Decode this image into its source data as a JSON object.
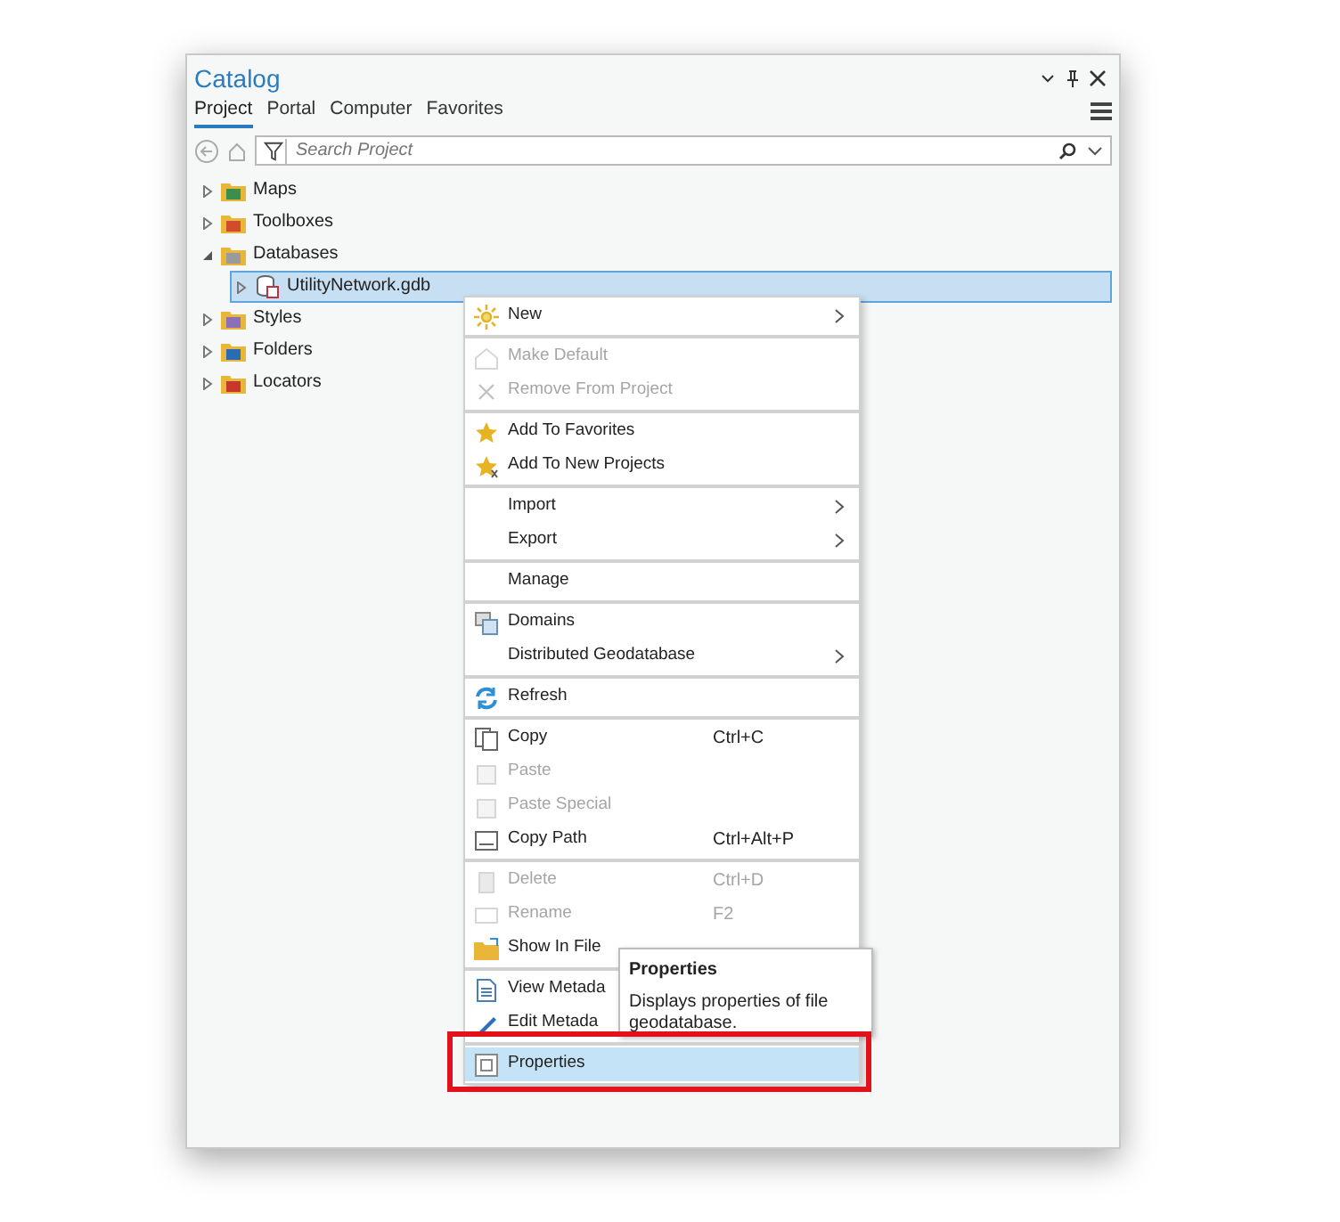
{
  "window": {
    "title": "Catalog"
  },
  "tabs": [
    {
      "label": "Project",
      "selected": true
    },
    {
      "label": "Portal",
      "selected": false
    },
    {
      "label": "Computer",
      "selected": false
    },
    {
      "label": "Favorites",
      "selected": false
    }
  ],
  "search": {
    "placeholder": "Search Project"
  },
  "tree": [
    {
      "label": "Maps",
      "expanded": false,
      "selected": false
    },
    {
      "label": "Toolboxes",
      "expanded": false,
      "selected": false
    },
    {
      "label": "Databases",
      "expanded": true,
      "selected": false,
      "children": [
        {
          "label": "UtilityNetwork.gdb",
          "expanded": false,
          "selected": true
        }
      ]
    },
    {
      "label": "Styles",
      "expanded": false,
      "selected": false
    },
    {
      "label": "Folders",
      "expanded": false,
      "selected": false
    },
    {
      "label": "Locators",
      "expanded": false,
      "selected": false
    }
  ],
  "context_menu": [
    {
      "kind": "item",
      "label": "New",
      "disabled": false,
      "submenu": true,
      "selected": false
    },
    {
      "kind": "separator"
    },
    {
      "kind": "item",
      "label": "Make Default",
      "disabled": true,
      "submenu": false,
      "selected": false
    },
    {
      "kind": "item",
      "label": "Remove From Project",
      "disabled": true,
      "submenu": false,
      "selected": false
    },
    {
      "kind": "separator"
    },
    {
      "kind": "item",
      "label": "Add To Favorites",
      "disabled": false,
      "submenu": false,
      "selected": false
    },
    {
      "kind": "item",
      "label": "Add To New Projects",
      "disabled": false,
      "submenu": false,
      "selected": false
    },
    {
      "kind": "separator"
    },
    {
      "kind": "item",
      "label": "Import",
      "disabled": false,
      "submenu": true,
      "selected": false
    },
    {
      "kind": "item",
      "label": "Export",
      "disabled": false,
      "submenu": true,
      "selected": false
    },
    {
      "kind": "separator"
    },
    {
      "kind": "item",
      "label": "Manage",
      "disabled": false,
      "submenu": false,
      "selected": false
    },
    {
      "kind": "separator"
    },
    {
      "kind": "item",
      "label": "Domains",
      "disabled": false,
      "submenu": false,
      "selected": false
    },
    {
      "kind": "item",
      "label": "Distributed Geodatabase",
      "disabled": false,
      "submenu": true,
      "selected": false
    },
    {
      "kind": "separator"
    },
    {
      "kind": "item",
      "label": "Refresh",
      "disabled": false,
      "submenu": false,
      "selected": false
    },
    {
      "kind": "separator"
    },
    {
      "kind": "item",
      "label": "Copy",
      "shortcut": "Ctrl+C",
      "disabled": false,
      "submenu": false,
      "selected": false
    },
    {
      "kind": "item",
      "label": "Paste",
      "disabled": true,
      "submenu": false,
      "selected": false
    },
    {
      "kind": "item",
      "label": "Paste Special",
      "disabled": true,
      "submenu": false,
      "selected": false
    },
    {
      "kind": "item",
      "label": "Copy Path",
      "shortcut": "Ctrl+Alt+P",
      "disabled": false,
      "submenu": false,
      "selected": false
    },
    {
      "kind": "separator"
    },
    {
      "kind": "item",
      "label": "Delete",
      "shortcut": "Ctrl+D",
      "disabled": true,
      "submenu": false,
      "selected": false
    },
    {
      "kind": "item",
      "label": "Rename",
      "shortcut": "F2",
      "disabled": true,
      "submenu": false,
      "selected": false
    },
    {
      "kind": "item",
      "label": "Show In File",
      "disabled": false,
      "submenu": false,
      "selected": false
    },
    {
      "kind": "separator"
    },
    {
      "kind": "item",
      "label": "View Metada",
      "disabled": false,
      "submenu": false,
      "selected": false
    },
    {
      "kind": "item",
      "label": "Edit Metada",
      "disabled": false,
      "submenu": false,
      "selected": false
    },
    {
      "kind": "separator"
    },
    {
      "kind": "item",
      "label": "Properties",
      "disabled": false,
      "submenu": false,
      "selected": true
    }
  ],
  "tooltip": {
    "title": "Properties",
    "text": "Displays properties of file geodatabase."
  }
}
